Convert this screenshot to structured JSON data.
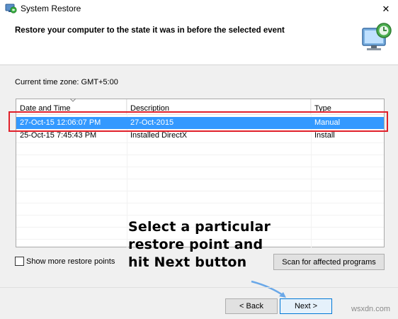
{
  "window": {
    "title": "System Restore",
    "close_glyph": "✕",
    "app_icon": "system-restore-icon"
  },
  "header": {
    "text": "Restore your computer to the state it was in before the selected event",
    "graphic_icon": "restore-monitor-icon"
  },
  "timezone": "Current time zone: GMT+5:00",
  "list": {
    "columns": [
      "Date and Time",
      "Description",
      "Type"
    ],
    "rows": [
      {
        "date": "27-Oct-15 12:06:07 PM",
        "description": "27-Oct-2015",
        "type": "Manual",
        "selected": true
      },
      {
        "date": "25-Oct-15 7:45:43 PM",
        "description": "Installed DirectX",
        "type": "Install",
        "selected": false
      }
    ]
  },
  "show_more": {
    "label": "Show more restore points",
    "checked": false
  },
  "buttons": {
    "scan": "Scan for affected programs",
    "back": "< Back",
    "next": "Next >"
  },
  "annotation": {
    "lines": [
      "Select a particular",
      "restore point and",
      "hit Next button"
    ]
  },
  "watermark": "wsxdn.com",
  "colors": {
    "selection": "#3399ff",
    "highlight_box": "#e0202a",
    "arrow": "#6aa8e8"
  }
}
